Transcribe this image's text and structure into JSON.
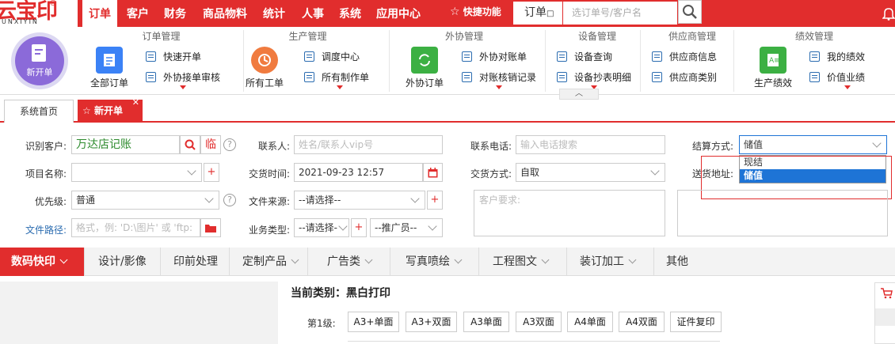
{
  "logo": {
    "text": "云宝印",
    "sub": "UNXIYIN",
    "reg": "®"
  },
  "nav": [
    "订单",
    "客户",
    "财务",
    "商品物料",
    "统计",
    "人事",
    "系统",
    "应用中心"
  ],
  "quick": {
    "label": "快捷功能",
    "select": "订单",
    "placeholder": "选订单号/客户名"
  },
  "toolbar": {
    "new_order": "新开单",
    "groups": {
      "order": {
        "title": "订单管理",
        "big": "全部订单",
        "items": [
          "快速开单",
          "外协接单审核"
        ]
      },
      "production": {
        "title": "生产管理",
        "big": "所有工单",
        "items": [
          "调度中心",
          "所有制作单"
        ]
      },
      "outsource": {
        "title": "外协管理",
        "big": "外协订单",
        "items": [
          "外协对账单",
          "对账核销记录"
        ]
      },
      "device": {
        "title": "设备管理",
        "items": [
          "设备查询",
          "设备抄表明细"
        ]
      },
      "supplier": {
        "title": "供应商管理",
        "items": [
          "供应商信息",
          "供应商类别"
        ]
      },
      "performance": {
        "title": "绩效管理",
        "big": "生产绩效",
        "items": [
          "我的绩效",
          "价值业绩"
        ]
      }
    },
    "collapse": "︿"
  },
  "tabs": {
    "home": "系统首页",
    "new": "新开单",
    "close": "✕"
  },
  "form": {
    "customer_label": "识别客户:",
    "customer_value": "万达店记账",
    "temp": "临",
    "contact_label": "联系人:",
    "contact_placeholder": "姓名/联系人vip号",
    "phone_label": "联系电话:",
    "phone_placeholder": "输入电话搜索",
    "settle_label": "结算方式:",
    "settle_value": "储值",
    "settle_options": [
      "现结",
      "储值"
    ],
    "project_label": "项目名称:",
    "time_label": "交货时间:",
    "time_value": "2021-09-23 12:57",
    "delivery_label": "交货方式:",
    "delivery_value": "自取",
    "address_label": "送货地址:",
    "priority_label": "优先级:",
    "priority_value": "普通",
    "source_label": "文件来源:",
    "source_value": "--请选择--",
    "request_placeholder": "客户要求:",
    "path_label": "文件路径:",
    "path_placeholder": "格式，例: 'D:\\图片' 或 'ftp:",
    "biz_label": "业务类型:",
    "biz_value": "--请选择-",
    "promoter_value": "--推广员--",
    "help": "?",
    "plus": "+"
  },
  "categories": [
    "数码快印",
    "设计/影像",
    "印前处理",
    "定制产品",
    "广告类",
    "写真喷绘",
    "工程图文",
    "装订加工",
    "其他"
  ],
  "current_category": "当前类别：黑白打印",
  "level_label": "第1级:",
  "products": [
    "A3+单面",
    "A3+双面",
    "A3单面",
    "A3双面",
    "A4单面",
    "A4双面",
    "证件复印"
  ],
  "colors": {
    "brand": "#e12d2d",
    "selected": "#1e74d6"
  },
  "icons": {
    "search": "search-icon",
    "bell": "bell-icon",
    "star": "star-icon",
    "calendar": "calendar-icon",
    "folder": "folder-icon",
    "cart": "cart-icon"
  }
}
